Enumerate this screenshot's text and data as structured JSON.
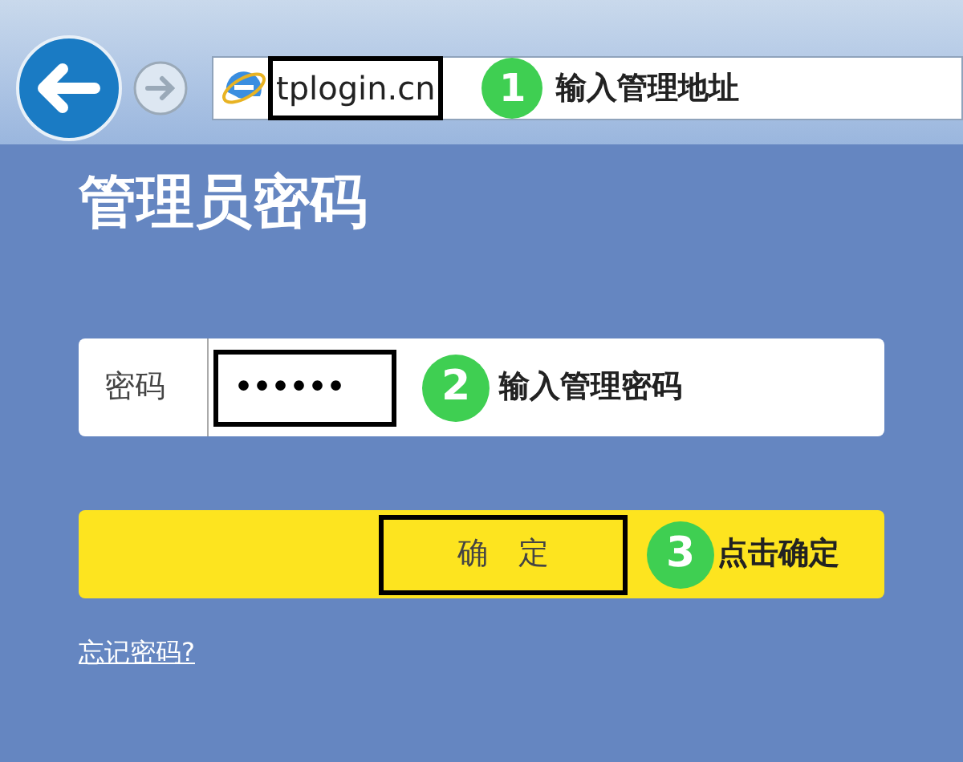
{
  "browser": {
    "address": "tplogin.cn",
    "step": {
      "number": "1",
      "text": "输入管理地址"
    }
  },
  "page_title": "管理员密码",
  "password": {
    "label": "密码",
    "value": "••••••",
    "step": {
      "number": "2",
      "text": "输入管理密码"
    }
  },
  "confirm_button": {
    "label": "确　定",
    "step": {
      "number": "3",
      "text": "点击确定"
    }
  },
  "forgot_link": "忘记密码?"
}
